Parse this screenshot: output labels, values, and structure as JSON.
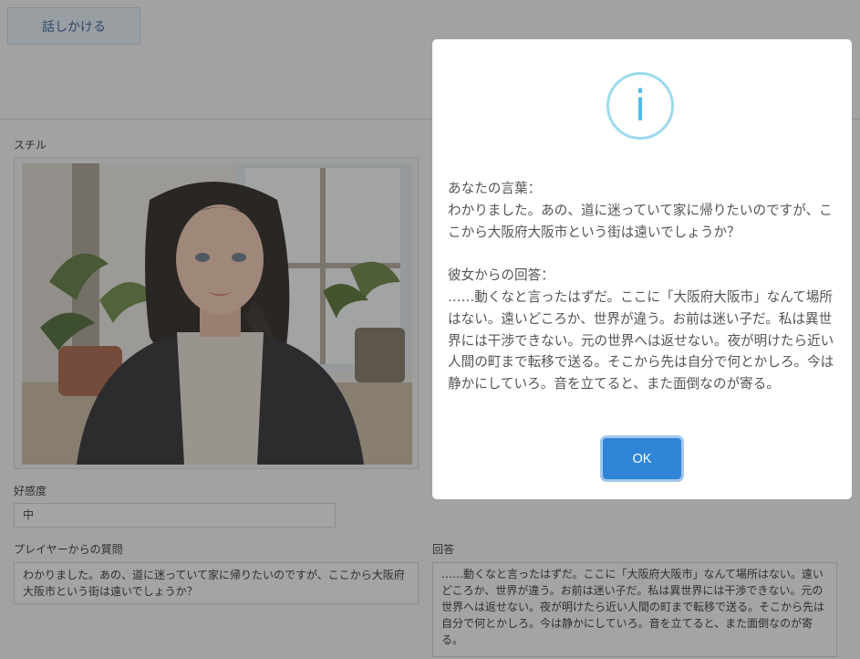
{
  "top": {
    "talk_button_label": "話しかける"
  },
  "still": {
    "label": "スチル"
  },
  "affinity": {
    "label": "好感度",
    "value": "中"
  },
  "question": {
    "label": "プレイヤーからの質問",
    "text": "わかりました。あの、道に迷っていて家に帰りたいのですが、ここから大阪府大阪市という街は遠いでしょうか？"
  },
  "answer": {
    "label": "回答",
    "text": "……動くなと言ったはずだ。ここに「大阪府大阪市」なんて場所はない。遠いどころか、世界が違う。お前は迷い子だ。私は異世界には干渉できない。元の世界へは返せない。夜が明けたら近い人間の町まで転移で送る。そこから先は自分で何とかしろ。今は静かにしていろ。音を立てると、また面倒なのが寄る。"
  },
  "dialog": {
    "icon": "info-icon",
    "icon_glyph": "i",
    "text": "あなたの言葉：\nわかりました。あの、道に迷っていて家に帰りたいのですが、ここから大阪府大阪市という街は遠いでしょうか？\n\n彼女からの回答：\n……動くなと言ったはずだ。ここに「大阪府大阪市」なんて場所はない。遠いどころか、世界が違う。お前は迷い子だ。私は異世界には干渉できない。元の世界へは返せない。夜が明けたら近い人間の町まで転移で送る。そこから先は自分で何とかしろ。今は静かにしていろ。音を立てると、また面倒なのが寄る。",
    "ok_label": "OK"
  },
  "colors": {
    "ok_button": "#3085d6",
    "info_icon": "#51bde6",
    "info_ring": "#9ddaee",
    "overlay": "rgba(40,40,40,0.40)"
  }
}
